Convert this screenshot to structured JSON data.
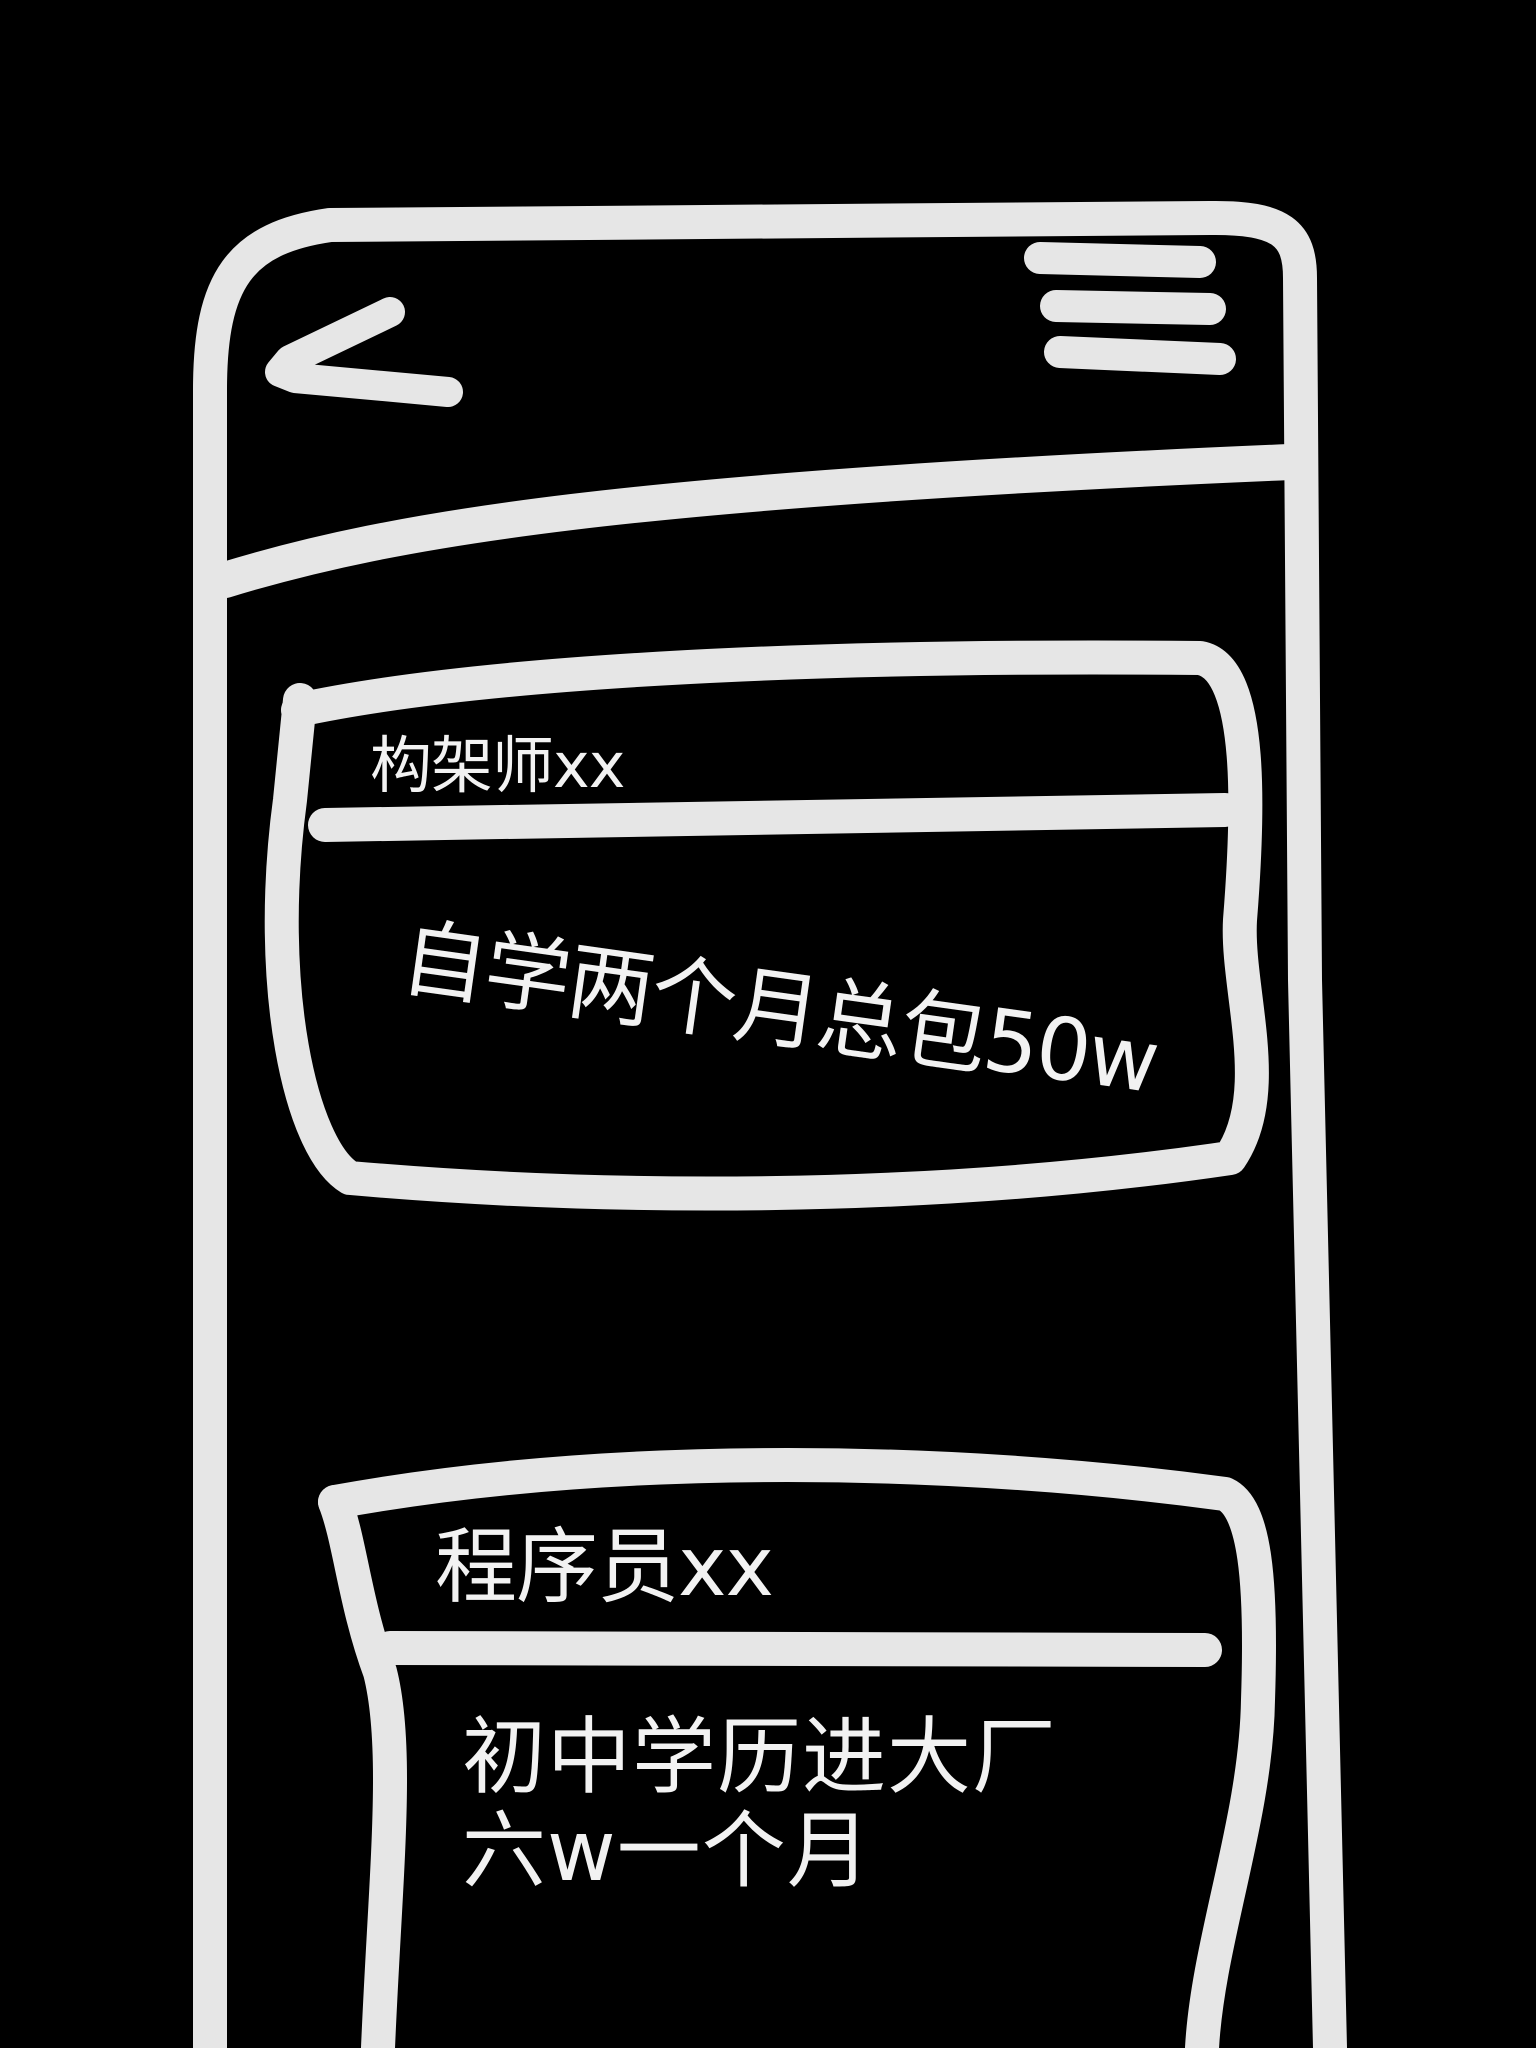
{
  "header": {
    "back_icon": "back-arrow-icon",
    "menu_icon": "hamburger-menu-icon"
  },
  "feed": {
    "posts": [
      {
        "author": "构架师xx",
        "content": "自学两个月总包50w"
      },
      {
        "author": "程序员xx",
        "content": "初中学历进大厂\n六w一个月"
      }
    ]
  },
  "colors": {
    "background": "#000000",
    "stroke": "#e6e6e6",
    "text": "#f2f2f2"
  }
}
